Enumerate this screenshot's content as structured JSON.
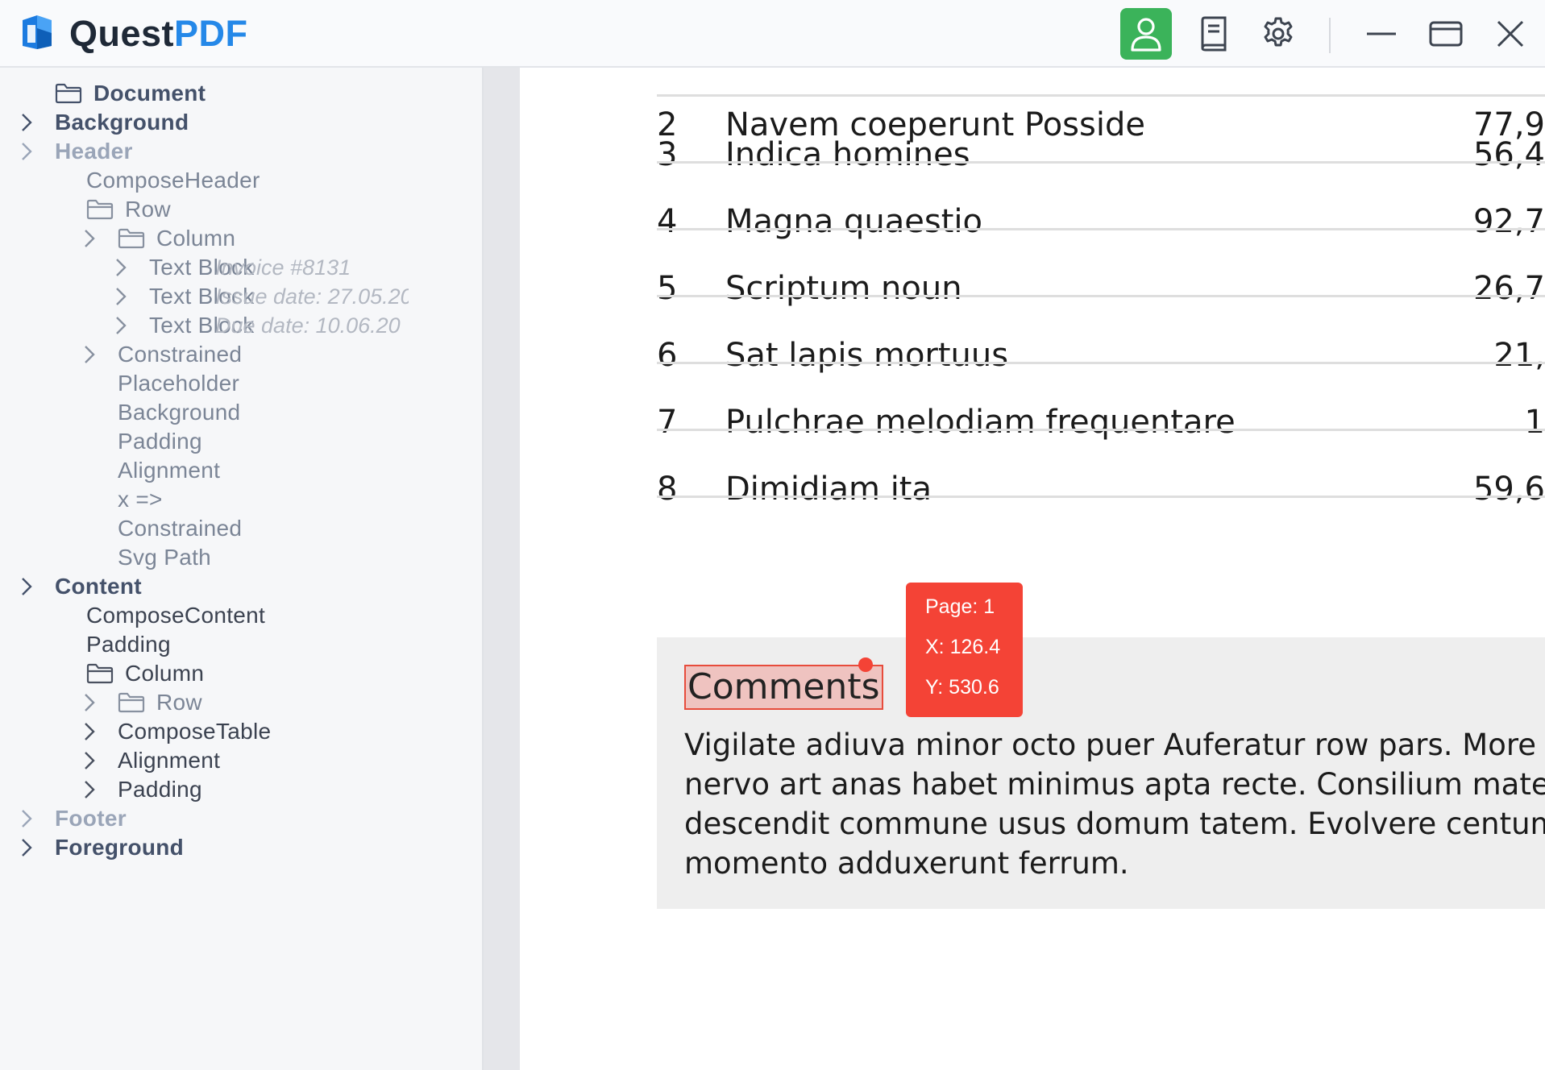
{
  "app": {
    "brand_quest": "Quest",
    "brand_pdf": "PDF",
    "brand_color": "#2588e8",
    "accent_color": "#3bb35a",
    "toolbar": [
      {
        "icon": "user-icon",
        "active": true
      },
      {
        "icon": "book-icon",
        "active": false
      },
      {
        "icon": "gear-icon",
        "active": false
      }
    ],
    "window_controls": [
      "minimize-icon",
      "maximize-icon",
      "close-icon"
    ]
  },
  "sidebar": {
    "items": [
      {
        "label": "Document",
        "hint": "",
        "style": "dark",
        "chevron": false,
        "folder": true,
        "depth": 0
      },
      {
        "label": "Background",
        "hint": "",
        "style": "dark",
        "chevron": true,
        "folder": false,
        "depth": 0
      },
      {
        "label": "Header",
        "hint": "",
        "style": "light",
        "chevron": true,
        "folder": false,
        "depth": 0
      },
      {
        "label": "ComposeHeader",
        "hint": "",
        "style": "mid",
        "chevron": false,
        "folder": false,
        "depth": 1
      },
      {
        "label": "Row",
        "hint": "",
        "style": "mid",
        "chevron": false,
        "folder": true,
        "depth": 1
      },
      {
        "label": "Column",
        "hint": "",
        "style": "mid",
        "chevron": true,
        "folder": true,
        "depth": 2
      },
      {
        "label": "Text Block",
        "hint": "Invoice #8131",
        "style": "mid",
        "chevron": true,
        "folder": false,
        "depth": 3
      },
      {
        "label": "Text Block",
        "hint": "Issue date:  27.05.20",
        "style": "mid",
        "chevron": true,
        "folder": false,
        "depth": 3
      },
      {
        "label": "Text Block",
        "hint": "Due date:  10.06.20",
        "style": "mid",
        "chevron": true,
        "folder": false,
        "depth": 3
      },
      {
        "label": "Constrained",
        "hint": "",
        "style": "mid",
        "chevron": true,
        "folder": false,
        "depth": 2
      },
      {
        "label": "Placeholder",
        "hint": "",
        "style": "mid",
        "chevron": false,
        "folder": false,
        "depth": 2
      },
      {
        "label": "Background",
        "hint": "",
        "style": "mid",
        "chevron": false,
        "folder": false,
        "depth": 2
      },
      {
        "label": "Padding",
        "hint": "",
        "style": "mid",
        "chevron": false,
        "folder": false,
        "depth": 2
      },
      {
        "label": "Alignment",
        "hint": "",
        "style": "mid",
        "chevron": false,
        "folder": false,
        "depth": 2
      },
      {
        "label": "x =>",
        "hint": "",
        "style": "mid",
        "chevron": false,
        "folder": false,
        "depth": 2
      },
      {
        "label": "Constrained",
        "hint": "",
        "style": "mid",
        "chevron": false,
        "folder": false,
        "depth": 2
      },
      {
        "label": "Svg Path",
        "hint": "",
        "style": "mid",
        "chevron": false,
        "folder": false,
        "depth": 2
      },
      {
        "label": "Content",
        "hint": "",
        "style": "dark",
        "chevron": true,
        "folder": false,
        "depth": 0
      },
      {
        "label": "ComposeContent",
        "hint": "",
        "style": "text",
        "chevron": false,
        "folder": false,
        "depth": 1
      },
      {
        "label": "Padding",
        "hint": "",
        "style": "text",
        "chevron": false,
        "folder": false,
        "depth": 1
      },
      {
        "label": "Column",
        "hint": "",
        "style": "text",
        "chevron": false,
        "folder": true,
        "depth": 1
      },
      {
        "label": "Row",
        "hint": "",
        "style": "mid",
        "chevron": true,
        "folder": true,
        "depth": 2
      },
      {
        "label": "ComposeTable",
        "hint": "",
        "style": "text",
        "chevron": true,
        "folder": false,
        "depth": 2
      },
      {
        "label": "Alignment",
        "hint": "",
        "style": "text",
        "chevron": true,
        "folder": false,
        "depth": 2
      },
      {
        "label": "Padding",
        "hint": "",
        "style": "text",
        "chevron": true,
        "folder": false,
        "depth": 2
      },
      {
        "label": "Footer",
        "hint": "",
        "style": "light",
        "chevron": true,
        "folder": false,
        "depth": 0
      },
      {
        "label": "Foreground",
        "hint": "",
        "style": "dark",
        "chevron": true,
        "folder": false,
        "depth": 0
      }
    ]
  },
  "preview": {
    "partial_row": {
      "num": "2",
      "name": "Navem coeperunt Posside",
      "value": "77,9"
    },
    "rows": [
      {
        "num": "3",
        "name": "Indica homines",
        "value": "56,4"
      },
      {
        "num": "4",
        "name": "Magna quaestio",
        "value": "92,7"
      },
      {
        "num": "5",
        "name": "Scriptum noun",
        "value": "26,7"
      },
      {
        "num": "6",
        "name": "Sat lapis mortuus",
        "value": "21,"
      },
      {
        "num": "7",
        "name": "Pulchrae melodiam frequentare",
        "value": "1"
      },
      {
        "num": "8",
        "name": "Dimidiam ita",
        "value": "59,6"
      }
    ],
    "comments_title": "Comments",
    "comments_body": "Vigilate adiuva minor octo puer Auferatur row pars. More au\nnervo art anas habet minimus apta recte. Consilium mater di\ndescendit commune usus domum tatem. Evolvere centum e\nmomento adduxerunt ferrum.",
    "tooltip": {
      "page": "Page: 1",
      "x": "X: 126.4",
      "y": "Y: 530.6"
    },
    "highlight_color": "#f44336"
  }
}
